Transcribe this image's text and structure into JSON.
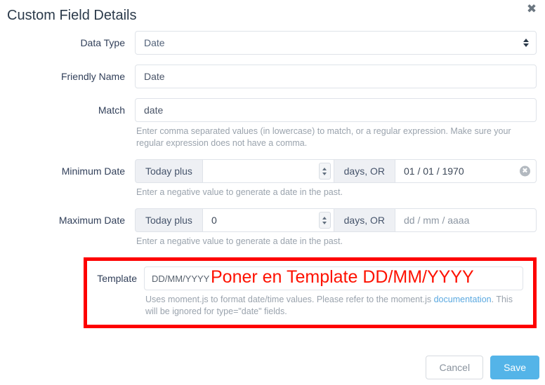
{
  "modal": {
    "title": "Custom Field Details",
    "close_icon": "close-icon"
  },
  "fields": {
    "data_type": {
      "label": "Data Type",
      "value": "Date",
      "options": [
        "Date"
      ]
    },
    "friendly_name": {
      "label": "Friendly Name",
      "value": "Date",
      "placeholder": ""
    },
    "match": {
      "label": "Match",
      "value": "date",
      "placeholder": "",
      "help": "Enter comma separated values (in lowercase) to match, or a regular expression. Make sure your regular expression does not have a comma."
    },
    "minimum_date": {
      "label": "Minimum Date",
      "prefix_label": "Today plus",
      "days_value": "",
      "days_placeholder": "",
      "suffix_label": "days, OR",
      "date_value": "01 / 01 / 1970",
      "date_placeholder": "dd / mm / aaaa",
      "clear_icon": "clear-circle-icon",
      "help": "Enter a negative value to generate a date in the past."
    },
    "maximum_date": {
      "label": "Maximum Date",
      "prefix_label": "Today plus",
      "days_value": "0",
      "days_placeholder": "",
      "suffix_label": "days, OR",
      "date_value": "",
      "date_placeholder": "dd / mm / aaaa",
      "help": "Enter a negative value to generate a date in the past."
    },
    "template": {
      "label": "Template",
      "value": "DD/MM/YYYY",
      "placeholder": "DD/MM/YYYY",
      "help_before": "Uses moment.js to format date/time values. Please refer to the moment.js ",
      "help_link": "documentation",
      "help_after": ". This will be ignored for type=\"date\" fields."
    }
  },
  "annotation": {
    "text": "Poner en Template DD/MM/YYYY",
    "color": "#fe1100",
    "box_color": "#fe0000"
  },
  "footer": {
    "cancel_label": "Cancel",
    "save_label": "Save",
    "save_color": "#54b4e8"
  }
}
